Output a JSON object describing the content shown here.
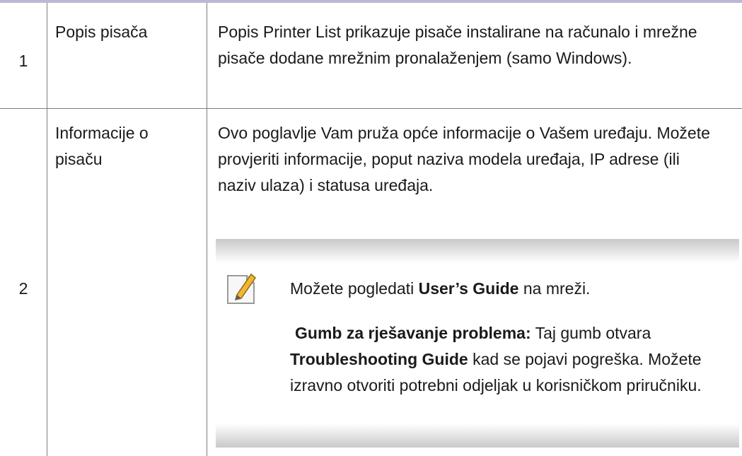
{
  "rows": [
    {
      "number": "1",
      "name": "Popis pisača",
      "description": "Popis Printer List prikazuje pisače instalirane na računalo i mrežne pisače dodane mrežnim pronalaženjem (samo Windows)."
    },
    {
      "number": "2",
      "name": "Informacije o pisaču",
      "description": "Ovo poglavlje Vam pruža opće informacije o Vašem uređaju. Možete provjeriti informacije, poput naziva modela uređaja, IP adrese (ili naziv ulaza) i statusa uređaja.",
      "note": {
        "icon": "note-pencil-icon",
        "line1_prefix": "Možete pogledati ",
        "line1_bold": "User’s Guide",
        "line1_suffix": " na mreži.",
        "line2_bold": "Gumb za rješavanje problema:",
        "line2_mid": " Taj gumb otvara ",
        "line2_bold2": "Troubleshooting Guide",
        "line2_suffix": " kad se pojavi pogreška. Možete izravno otvoriti potrebni odjeljak u korisničkom priručniku."
      }
    }
  ]
}
